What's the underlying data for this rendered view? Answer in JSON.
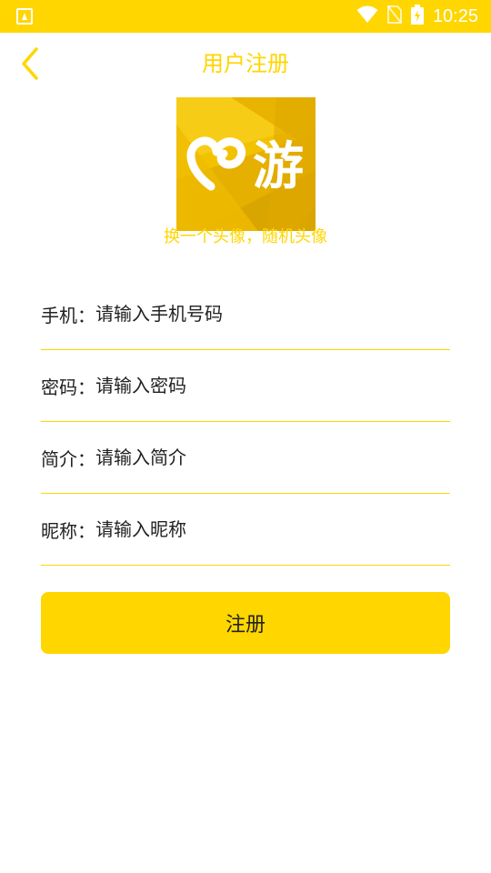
{
  "status_bar": {
    "time": "10:25",
    "icons": [
      "app-notification-icon",
      "wifi-icon",
      "no-sim-icon",
      "battery-charging-icon"
    ]
  },
  "header": {
    "title": "用户注册",
    "back_icon": "chevron-left-icon"
  },
  "avatar": {
    "logo_text": "游",
    "caption": "换一个头像，随机头像"
  },
  "form": {
    "phone": {
      "label": "手机：",
      "placeholder": "请输入手机号码",
      "value": ""
    },
    "password": {
      "label": "密码：",
      "placeholder": "请输入密码",
      "value": ""
    },
    "bio": {
      "label": "简介：",
      "placeholder": "请输入简介",
      "value": ""
    },
    "nickname": {
      "label": "昵称：",
      "placeholder": "请输入昵称",
      "value": ""
    }
  },
  "submit_label": "注册",
  "colors": {
    "accent": "#FFD600",
    "text": "#222222",
    "background": "#FFFFFF"
  }
}
